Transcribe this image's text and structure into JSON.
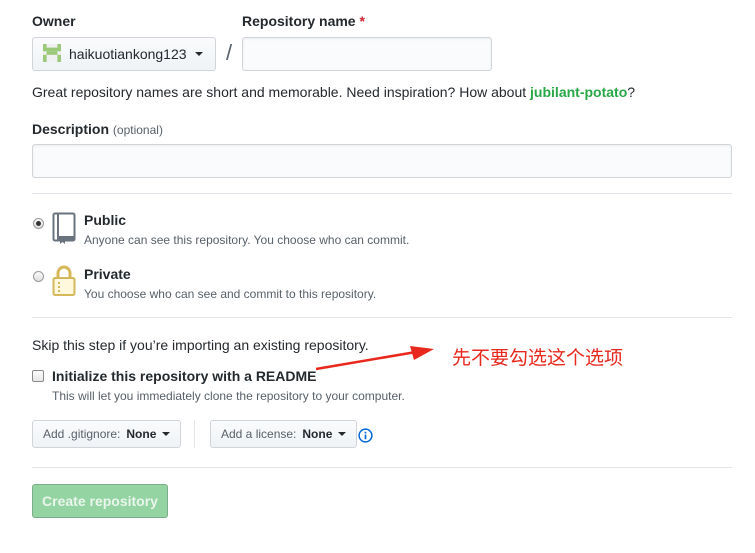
{
  "owner": {
    "label": "Owner",
    "value": "haikuotiankong123"
  },
  "repo_name": {
    "label": "Repository name",
    "required_mark": "*",
    "value": ""
  },
  "separator": "/",
  "name_hint": {
    "text": "Great repository names are short and memorable. Need inspiration? How about ",
    "suggestion": "jubilant-potato",
    "suffix": "?"
  },
  "description": {
    "label": "Description",
    "optional": "(optional)",
    "value": ""
  },
  "visibility": {
    "selected": "public",
    "public": {
      "title": "Public",
      "note": "Anyone can see this repository. You choose who can commit."
    },
    "private": {
      "title": "Private",
      "note": "You choose who can see and commit to this repository."
    }
  },
  "init": {
    "skip_text": "Skip this step if you’re importing an existing repository.",
    "readme_label": "Initialize this repository with a README",
    "readme_note": "This will let you immediately clone the repository to your computer.",
    "checked": false
  },
  "gitignore": {
    "prefix": "Add .gitignore:",
    "value": "None"
  },
  "license": {
    "prefix": "Add a license:",
    "value": "None"
  },
  "create_button": "Create repository",
  "annotation": "先不要勾选这个选项",
  "colors": {
    "accent_green": "#28a745",
    "disabled_button": "#94d3a2",
    "annotation_red": "#e8281c",
    "info_blue": "#0366d6"
  }
}
